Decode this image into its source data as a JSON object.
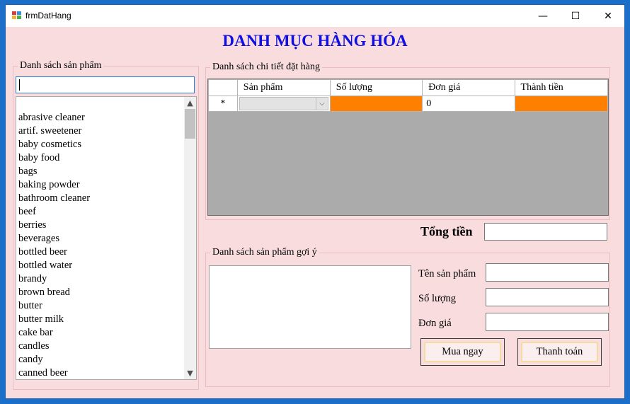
{
  "window": {
    "title": "frmDatHang",
    "minimize": "—",
    "maximize": "☐",
    "close": "✕"
  },
  "header": {
    "title": "DANH MỤC HÀNG HÓA"
  },
  "product_list": {
    "legend": "Danh sách sản phẩm",
    "search_value": "",
    "items": [
      "abrasive cleaner",
      "artif. sweetener",
      "baby cosmetics",
      "baby food",
      "bags",
      "baking powder",
      "bathroom cleaner",
      "beef",
      "berries",
      "beverages",
      "bottled beer",
      "bottled water",
      "brandy",
      "brown bread",
      "butter",
      "butter milk",
      "cake bar",
      "candles",
      "candy",
      "canned beer"
    ],
    "scroll_up": "▲",
    "scroll_down": "▼"
  },
  "order_details": {
    "legend": "Danh sách chi tiết đặt hàng",
    "columns": [
      "Sản phẩm",
      "Số lượng",
      "Đơn giá",
      "Thành tiền"
    ],
    "new_row_marker": "*",
    "new_row": {
      "product": "",
      "quantity": "",
      "price": "0",
      "total": ""
    },
    "combo_arrow": "⌵"
  },
  "total": {
    "label": "Tổng tiền",
    "value": ""
  },
  "suggested": {
    "legend": "Danh sách sản phẩm gợi ý"
  },
  "form": {
    "product_name_label": "Tên sản phẩm",
    "quantity_label": "Số lượng",
    "price_label": "Đơn giá",
    "product_name_value": "",
    "quantity_value": "",
    "price_value": ""
  },
  "buttons": {
    "buy_now": "Mua ngay",
    "checkout": "Thanh toán"
  },
  "colors": {
    "form_bg": "#f9dcde",
    "title_blue": "#1010e0",
    "highlight_orange": "#ff8000",
    "grid_gray": "#ababab"
  }
}
